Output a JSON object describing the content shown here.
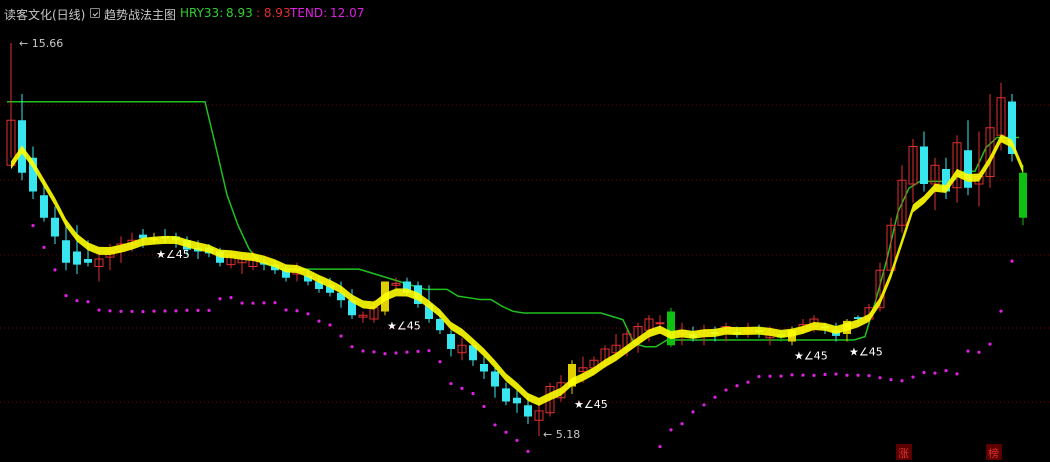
{
  "header": {
    "title": "读客文化(日线)",
    "main_chart": "趋势战法主图",
    "ind1_label": "HRY33:",
    "ind1_value": "8.93",
    "ind2_value": ": 8.93",
    "ind3_label": "TEND:",
    "ind3_value": "12.07"
  },
  "colors": {
    "background": "#000000",
    "grid": "#7a0000",
    "up_candle": "#e03030",
    "down_candle": "#38e6f0",
    "band_up": "#ffff00",
    "band_down": "#1a1ad8",
    "dots": "#e020e0",
    "stop_line_green": "#20c020",
    "stop_line_red": "#e00000",
    "label_green": "#30d030",
    "label_red": "#e03030",
    "label_magenta": "#e020e0"
  },
  "chart_data": {
    "type": "candlestick",
    "ylim": [
      5.18,
      15.66
    ],
    "markers": {
      "high_label": "15.66",
      "low_label": "5.18",
      "signal_text": "★∠45"
    },
    "candles": [
      {
        "o": 13.6,
        "h": 15.66,
        "l": 12.6,
        "c": 12.4,
        "k": "up"
      },
      {
        "o": 12.2,
        "h": 14.3,
        "l": 12.0,
        "c": 13.6,
        "k": "dn"
      },
      {
        "o": 12.6,
        "h": 12.9,
        "l": 11.5,
        "c": 11.7,
        "k": "dn"
      },
      {
        "o": 11.6,
        "h": 12.0,
        "l": 10.9,
        "c": 11.0,
        "k": "dn"
      },
      {
        "o": 11.0,
        "h": 11.3,
        "l": 10.3,
        "c": 10.5,
        "k": "dn"
      },
      {
        "o": 10.4,
        "h": 10.9,
        "l": 9.6,
        "c": 9.8,
        "k": "dn"
      },
      {
        "o": 10.1,
        "h": 10.8,
        "l": 9.5,
        "c": 9.75,
        "k": "dn"
      },
      {
        "o": 9.9,
        "h": 10.4,
        "l": 9.7,
        "c": 9.8,
        "k": "dn"
      },
      {
        "o": 9.7,
        "h": 10.1,
        "l": 9.3,
        "c": 9.9,
        "k": "up"
      },
      {
        "o": 9.95,
        "h": 10.3,
        "l": 9.6,
        "c": 10.1,
        "k": "up"
      },
      {
        "o": 10.1,
        "h": 10.5,
        "l": 9.8,
        "c": 10.3,
        "k": "up"
      },
      {
        "o": 10.3,
        "h": 10.6,
        "l": 10.1,
        "c": 10.4,
        "k": "up"
      },
      {
        "o": 10.45,
        "h": 10.7,
        "l": 10.2,
        "c": 10.55,
        "k": "dn"
      },
      {
        "o": 10.4,
        "h": 10.6,
        "l": 10.3,
        "c": 10.45,
        "k": "y"
      },
      {
        "o": 10.5,
        "h": 10.7,
        "l": 10.3,
        "c": 10.45,
        "k": "dn"
      },
      {
        "o": 10.5,
        "h": 10.6,
        "l": 10.2,
        "c": 10.4,
        "k": "dn"
      },
      {
        "o": 10.4,
        "h": 10.5,
        "l": 10.0,
        "c": 10.15,
        "k": "dn"
      },
      {
        "o": 10.2,
        "h": 10.4,
        "l": 9.9,
        "c": 10.1,
        "k": "dn"
      },
      {
        "o": 10.2,
        "h": 10.3,
        "l": 9.95,
        "c": 10.05,
        "k": "dn"
      },
      {
        "o": 10.1,
        "h": 10.2,
        "l": 9.7,
        "c": 9.8,
        "k": "dn"
      },
      {
        "o": 9.75,
        "h": 10.1,
        "l": 9.65,
        "c": 10.0,
        "k": "up"
      },
      {
        "o": 9.8,
        "h": 10.0,
        "l": 9.5,
        "c": 9.9,
        "k": "up"
      },
      {
        "o": 9.7,
        "h": 10.1,
        "l": 9.6,
        "c": 9.9,
        "k": "up"
      },
      {
        "o": 9.8,
        "h": 9.9,
        "l": 9.6,
        "c": 9.75,
        "k": "dn"
      },
      {
        "o": 9.75,
        "h": 9.85,
        "l": 9.5,
        "c": 9.6,
        "k": "dn"
      },
      {
        "o": 9.6,
        "h": 9.75,
        "l": 9.3,
        "c": 9.4,
        "k": "dn"
      },
      {
        "o": 9.5,
        "h": 9.8,
        "l": 9.3,
        "c": 9.6,
        "k": "up"
      },
      {
        "o": 9.45,
        "h": 9.6,
        "l": 9.2,
        "c": 9.3,
        "k": "dn"
      },
      {
        "o": 9.3,
        "h": 9.45,
        "l": 9.0,
        "c": 9.1,
        "k": "dn"
      },
      {
        "o": 9.2,
        "h": 9.4,
        "l": 8.9,
        "c": 9.0,
        "k": "dn"
      },
      {
        "o": 9.0,
        "h": 9.3,
        "l": 8.6,
        "c": 8.8,
        "k": "dn"
      },
      {
        "o": 8.8,
        "h": 9.1,
        "l": 8.3,
        "c": 8.4,
        "k": "dn"
      },
      {
        "o": 8.35,
        "h": 8.5,
        "l": 8.2,
        "c": 8.4,
        "k": "up"
      },
      {
        "o": 8.3,
        "h": 8.8,
        "l": 8.2,
        "c": 8.6,
        "k": "up"
      },
      {
        "o": 8.5,
        "h": 9.3,
        "l": 8.4,
        "c": 9.3,
        "k": "y"
      },
      {
        "o": 9.2,
        "h": 9.4,
        "l": 9.1,
        "c": 9.25,
        "k": "up"
      },
      {
        "o": 9.3,
        "h": 9.4,
        "l": 8.9,
        "c": 9.0,
        "k": "dn"
      },
      {
        "o": 9.2,
        "h": 9.3,
        "l": 8.6,
        "c": 8.7,
        "k": "dn"
      },
      {
        "o": 8.7,
        "h": 9.2,
        "l": 8.2,
        "c": 8.3,
        "k": "dn"
      },
      {
        "o": 8.3,
        "h": 8.5,
        "l": 7.9,
        "c": 8.0,
        "k": "dn"
      },
      {
        "o": 7.9,
        "h": 8.0,
        "l": 7.3,
        "c": 7.5,
        "k": "dn"
      },
      {
        "o": 7.4,
        "h": 7.8,
        "l": 7.2,
        "c": 7.6,
        "k": "up"
      },
      {
        "o": 7.6,
        "h": 7.75,
        "l": 7.05,
        "c": 7.2,
        "k": "dn"
      },
      {
        "o": 7.1,
        "h": 7.3,
        "l": 6.7,
        "c": 6.9,
        "k": "dn"
      },
      {
        "o": 6.9,
        "h": 7.0,
        "l": 6.2,
        "c": 6.5,
        "k": "dn"
      },
      {
        "o": 6.45,
        "h": 6.6,
        "l": 6.0,
        "c": 6.1,
        "k": "dn"
      },
      {
        "o": 6.2,
        "h": 6.4,
        "l": 5.8,
        "c": 6.05,
        "k": "dn"
      },
      {
        "o": 6.0,
        "h": 6.3,
        "l": 5.5,
        "c": 5.7,
        "k": "dn"
      },
      {
        "o": 5.6,
        "h": 6.2,
        "l": 5.18,
        "c": 5.85,
        "k": "up"
      },
      {
        "o": 5.8,
        "h": 6.6,
        "l": 5.7,
        "c": 6.5,
        "k": "up"
      },
      {
        "o": 6.2,
        "h": 6.8,
        "l": 6.1,
        "c": 6.6,
        "k": "up"
      },
      {
        "o": 6.5,
        "h": 7.2,
        "l": 6.3,
        "c": 7.1,
        "k": "y"
      },
      {
        "o": 6.9,
        "h": 7.3,
        "l": 6.6,
        "c": 7.0,
        "k": "up"
      },
      {
        "o": 7.0,
        "h": 7.3,
        "l": 6.8,
        "c": 7.2,
        "k": "up"
      },
      {
        "o": 7.1,
        "h": 7.6,
        "l": 7.0,
        "c": 7.5,
        "k": "up"
      },
      {
        "o": 7.4,
        "h": 7.9,
        "l": 7.2,
        "c": 7.6,
        "k": "up"
      },
      {
        "o": 7.5,
        "h": 8.0,
        "l": 7.3,
        "c": 7.9,
        "k": "up"
      },
      {
        "o": 7.7,
        "h": 8.2,
        "l": 7.4,
        "c": 8.1,
        "k": "up"
      },
      {
        "o": 8.0,
        "h": 8.4,
        "l": 7.7,
        "c": 8.3,
        "k": "up"
      },
      {
        "o": 8.2,
        "h": 8.4,
        "l": 7.9,
        "c": 8.2,
        "k": "up"
      },
      {
        "o": 8.5,
        "h": 8.6,
        "l": 7.55,
        "c": 7.6,
        "k": "g"
      },
      {
        "o": 7.9,
        "h": 8.2,
        "l": 7.6,
        "c": 8.0,
        "k": "up"
      },
      {
        "o": 7.9,
        "h": 8.1,
        "l": 7.7,
        "c": 7.8,
        "k": "dn"
      },
      {
        "o": 7.85,
        "h": 8.15,
        "l": 7.6,
        "c": 8.0,
        "k": "up"
      },
      {
        "o": 7.9,
        "h": 8.1,
        "l": 7.7,
        "c": 7.95,
        "k": "dn"
      },
      {
        "o": 7.95,
        "h": 8.2,
        "l": 7.7,
        "c": 8.1,
        "k": "up"
      },
      {
        "o": 7.9,
        "h": 8.1,
        "l": 7.8,
        "c": 7.95,
        "k": "dn"
      },
      {
        "o": 7.95,
        "h": 8.2,
        "l": 7.8,
        "c": 8.0,
        "k": "up"
      },
      {
        "o": 7.95,
        "h": 8.15,
        "l": 7.8,
        "c": 8.0,
        "k": "dn"
      },
      {
        "o": 7.8,
        "h": 8.1,
        "l": 7.6,
        "c": 7.9,
        "k": "up"
      },
      {
        "o": 7.9,
        "h": 8.0,
        "l": 7.7,
        "c": 7.8,
        "k": "g"
      },
      {
        "o": 7.7,
        "h": 8.1,
        "l": 7.6,
        "c": 8.0,
        "k": "y"
      },
      {
        "o": 8.0,
        "h": 8.3,
        "l": 7.9,
        "c": 8.15,
        "k": "up"
      },
      {
        "o": 8.1,
        "h": 8.4,
        "l": 7.95,
        "c": 8.3,
        "k": "up"
      },
      {
        "o": 8.1,
        "h": 8.2,
        "l": 7.9,
        "c": 8.05,
        "k": "dn"
      },
      {
        "o": 8.0,
        "h": 8.2,
        "l": 7.7,
        "c": 7.85,
        "k": "dn"
      },
      {
        "o": 7.9,
        "h": 8.3,
        "l": 7.7,
        "c": 8.25,
        "k": "y"
      },
      {
        "o": 8.3,
        "h": 8.4,
        "l": 8.2,
        "c": 8.35,
        "k": "dn"
      },
      {
        "o": 8.3,
        "h": 8.7,
        "l": 8.2,
        "c": 8.6,
        "k": "up"
      },
      {
        "o": 8.6,
        "h": 9.8,
        "l": 8.5,
        "c": 9.6,
        "k": "up"
      },
      {
        "o": 9.6,
        "h": 11.0,
        "l": 9.4,
        "c": 10.8,
        "k": "up"
      },
      {
        "o": 10.8,
        "h": 12.4,
        "l": 10.6,
        "c": 12.0,
        "k": "up"
      },
      {
        "o": 11.9,
        "h": 13.1,
        "l": 11.4,
        "c": 12.9,
        "k": "up"
      },
      {
        "o": 12.9,
        "h": 13.3,
        "l": 11.7,
        "c": 11.9,
        "k": "dn"
      },
      {
        "o": 11.9,
        "h": 12.6,
        "l": 11.2,
        "c": 12.4,
        "k": "up"
      },
      {
        "o": 12.3,
        "h": 12.6,
        "l": 11.5,
        "c": 11.7,
        "k": "dn"
      },
      {
        "o": 11.8,
        "h": 13.2,
        "l": 11.4,
        "c": 13.0,
        "k": "up"
      },
      {
        "o": 12.8,
        "h": 13.6,
        "l": 11.6,
        "c": 11.8,
        "k": "dn"
      },
      {
        "o": 11.9,
        "h": 13.3,
        "l": 11.3,
        "c": 12.1,
        "k": "up"
      },
      {
        "o": 12.1,
        "h": 14.3,
        "l": 11.8,
        "c": 13.4,
        "k": "up"
      },
      {
        "o": 13.2,
        "h": 14.6,
        "l": 12.8,
        "c": 14.2,
        "k": "up"
      },
      {
        "o": 14.1,
        "h": 14.3,
        "l": 12.5,
        "c": 12.7,
        "k": "dn"
      },
      {
        "o": 12.2,
        "h": 12.4,
        "l": 10.8,
        "c": 11.0,
        "k": "g"
      }
    ],
    "bottom_marks": [
      "涨",
      "榜"
    ]
  }
}
